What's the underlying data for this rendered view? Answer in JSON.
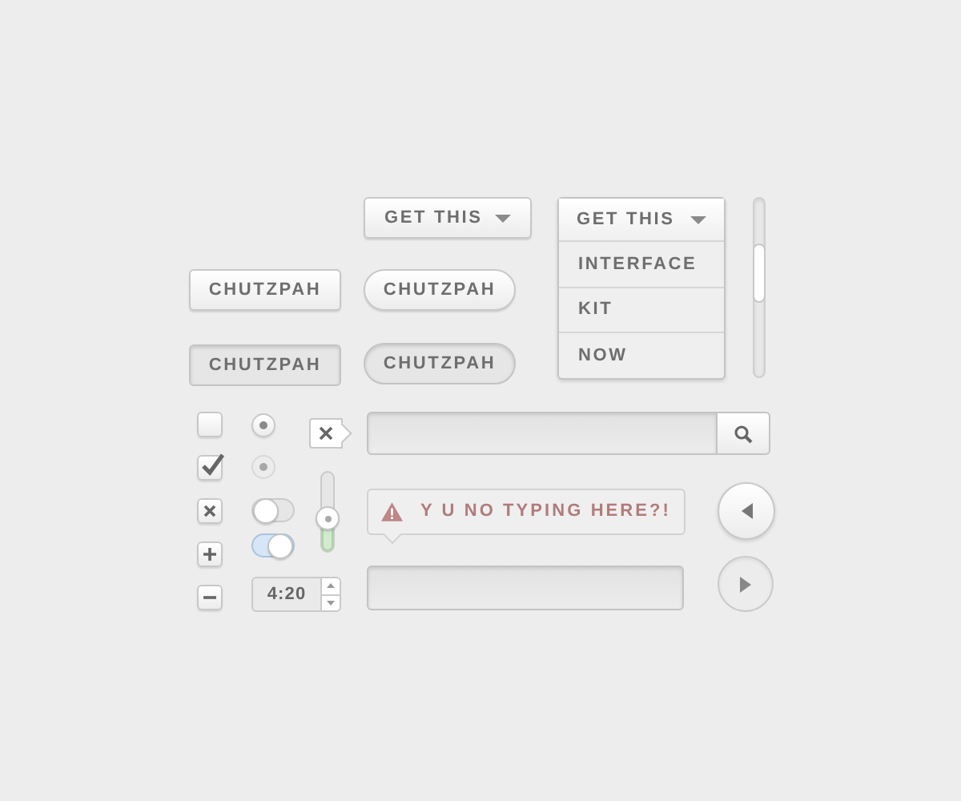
{
  "dropdown_button": {
    "label": "GET THIS"
  },
  "buttons": [
    {
      "label": "CHUTZPAH",
      "kind": "square",
      "pressed": false
    },
    {
      "label": "CHUTZPAH",
      "kind": "square",
      "pressed": true
    },
    {
      "label": "CHUTZPAH",
      "kind": "pill",
      "pressed": false
    },
    {
      "label": "CHUTZPAH",
      "kind": "pill",
      "pressed": true
    }
  ],
  "dropdown_menu": {
    "label": "GET THIS",
    "items": [
      "INTERFACE",
      "KIT",
      "NOW"
    ]
  },
  "checkboxes": [
    {
      "kind": "box",
      "checked": false
    },
    {
      "kind": "box",
      "checked": true
    },
    {
      "kind": "cross"
    },
    {
      "kind": "plus"
    },
    {
      "kind": "minus"
    }
  ],
  "radios": [
    {
      "selected": true,
      "disabled": false
    },
    {
      "selected": true,
      "disabled": true
    }
  ],
  "toggles": [
    {
      "on": false
    },
    {
      "on": true
    }
  ],
  "slider": {
    "level": 0.4
  },
  "stepper": {
    "value": "4:20"
  },
  "alert": {
    "text": "Y U NO TYPING HERE?!"
  }
}
